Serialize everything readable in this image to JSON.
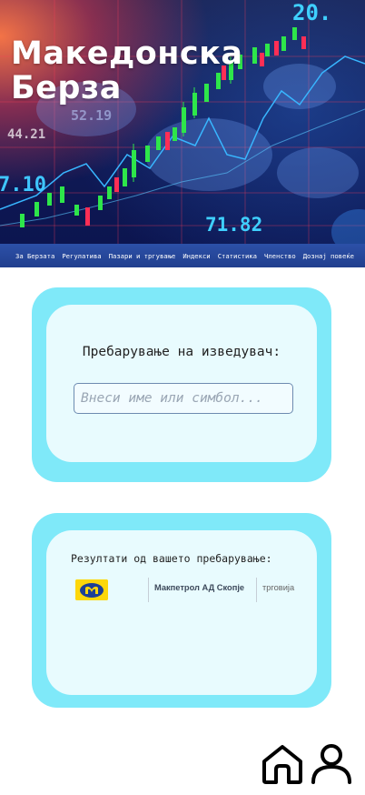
{
  "hero": {
    "title": "Македонска Берза",
    "chart_numbers": [
      "20.",
      "52.19",
      "44.21",
      "7.10",
      "71.82"
    ]
  },
  "nav": {
    "items": [
      "За Берзата",
      "Регулатива",
      "Пазари и тргување",
      "Индекси",
      "Статистика",
      "Членство",
      "Дознај повеќе"
    ]
  },
  "search": {
    "label": "Пребарување на изведувач:",
    "placeholder": "Внеси име или симбол..."
  },
  "results": {
    "title": "Резултати од вашето пребарување:",
    "items": [
      {
        "logo": "makpetrol-logo",
        "name": "Макпетрол АД Скопје",
        "category": "трговија"
      }
    ]
  },
  "colors": {
    "card_outer": "#7fe9f9",
    "card_inner": "#e8fbfe",
    "nav_bar": "#2446a0",
    "candle_green": "#2ee64a",
    "candle_red": "#ff2e55",
    "logo_yellow": "#fdd70a",
    "logo_blue": "#1d3f95"
  },
  "icons": [
    "home-icon",
    "user-icon"
  ]
}
